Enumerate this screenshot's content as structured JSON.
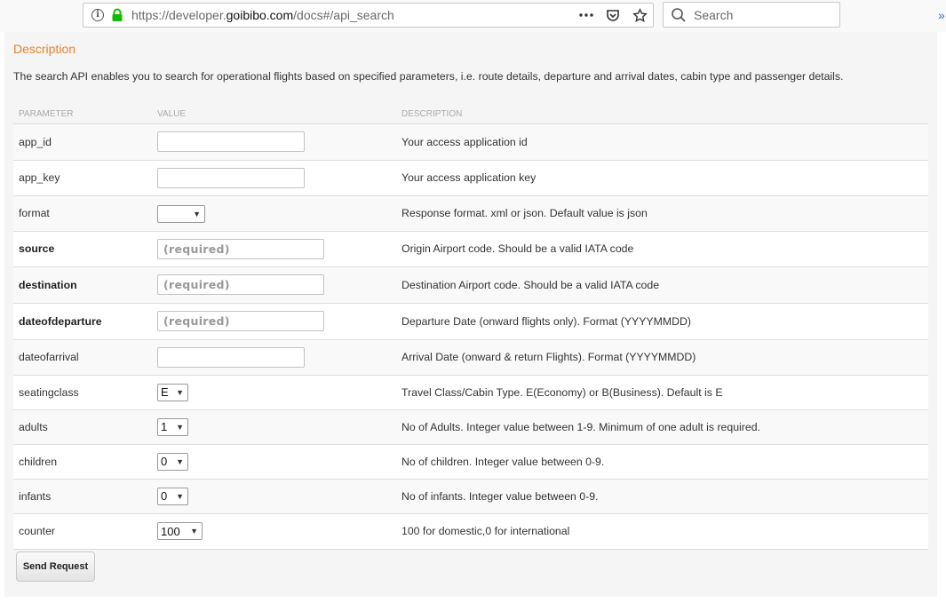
{
  "browser": {
    "url_prefix": "https://developer.",
    "url_host": "goibibo.com",
    "url_path": "/docs#/api_search",
    "search_placeholder": "Search"
  },
  "section": {
    "title": "Description",
    "description": "The search API enables you to search for operational flights based on specified parameters, i.e. route details, departure and arrival dates, cabin type and passenger details."
  },
  "table": {
    "headers": {
      "parameter": "PARAMETER",
      "value": "VALUE",
      "description": "DESCRIPTION"
    },
    "rows": [
      {
        "name": "app_id",
        "description": "Your access application id",
        "placeholder": ""
      },
      {
        "name": "app_key",
        "description": "Your access application key",
        "placeholder": ""
      },
      {
        "name": "format",
        "description": "Response format. xml or json. Default value is json",
        "selected": ""
      },
      {
        "name": "source",
        "description": "Origin Airport code. Should be a valid IATA code",
        "placeholder": "(required)"
      },
      {
        "name": "destination",
        "description": "Destination Airport code. Should be a valid IATA code",
        "placeholder": "(required)"
      },
      {
        "name": "dateofdeparture",
        "description": "Departure Date (onward flights only). Format (YYYYMMDD)",
        "placeholder": "(required)"
      },
      {
        "name": "dateofarrival",
        "description": "Arrival Date (onward & return Flights). Format (YYYYMMDD)",
        "placeholder": ""
      },
      {
        "name": "seatingclass",
        "description": "Travel Class/Cabin Type. E(Economy) or B(Business). Default is E",
        "selected": "E"
      },
      {
        "name": "adults",
        "description": "No of Adults. Integer value between 1-9. Minimum of one adult is required.",
        "selected": "1"
      },
      {
        "name": "children",
        "description": "No of children. Integer value between 0-9.",
        "selected": "0"
      },
      {
        "name": "infants",
        "description": "No of infants. Integer value between 0-9.",
        "selected": "0"
      },
      {
        "name": "counter",
        "description": "100 for domestic,0 for international",
        "selected": "100"
      }
    ]
  },
  "send_button": "Send Request",
  "colors": {
    "accent": "#e8832b",
    "link_arrow": "#2a6fd6"
  }
}
